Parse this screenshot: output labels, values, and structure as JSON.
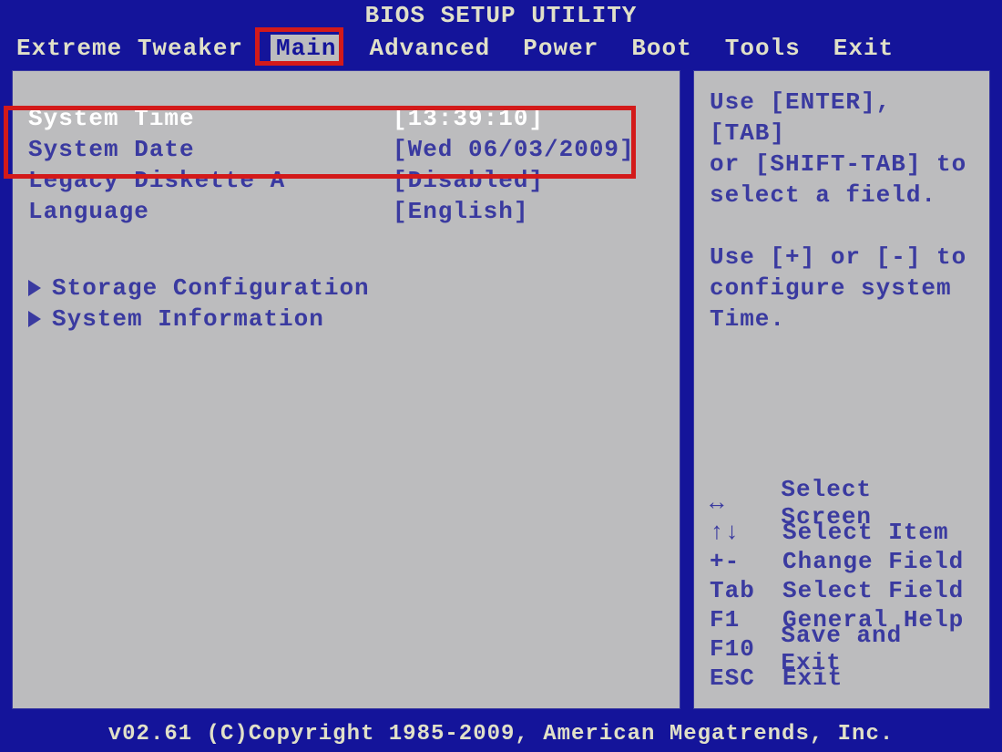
{
  "title": "BIOS SETUP UTILITY",
  "menu": {
    "items": [
      "Extreme Tweaker",
      "Main",
      "Advanced",
      "Power",
      "Boot",
      "Tools",
      "Exit"
    ],
    "active_index": 1
  },
  "main": {
    "rows": [
      {
        "label": "System Time",
        "value": "[13:39:10]",
        "selected": true
      },
      {
        "label": "System Date",
        "value": "[Wed 06/03/2009]",
        "selected": false
      },
      {
        "label": "Legacy Diskette A",
        "value": "[Disabled]",
        "selected": false
      },
      {
        "label": "Language",
        "value": "[English]",
        "selected": false
      }
    ],
    "submenus": [
      "Storage Configuration",
      "System Information"
    ]
  },
  "help": {
    "lines": [
      "Use [ENTER], [TAB]",
      "or [SHIFT-TAB] to",
      "select a field.",
      "",
      "Use [+] or [-] to",
      "configure system Time."
    ],
    "keys": [
      {
        "key": "↔",
        "desc": "Select Screen"
      },
      {
        "key": "↑↓",
        "desc": "Select Item"
      },
      {
        "key": "+-",
        "desc": "Change Field"
      },
      {
        "key": "Tab",
        "desc": "Select Field"
      },
      {
        "key": "F1",
        "desc": "General Help"
      },
      {
        "key": "F10",
        "desc": "Save and Exit"
      },
      {
        "key": "ESC",
        "desc": "Exit"
      }
    ]
  },
  "footer": "v02.61 (C)Copyright 1985-2009, American Megatrends, Inc.",
  "annotations": {
    "main_tab_box": true,
    "time_date_box": true
  }
}
